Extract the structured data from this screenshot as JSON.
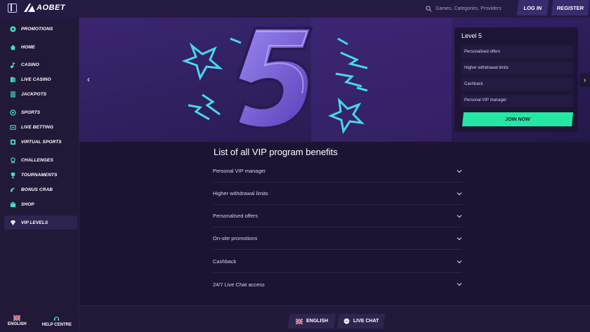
{
  "header": {
    "logo": "AOBET",
    "search_placeholder": "Games, Categories, Providers",
    "login_label": "LOG IN",
    "register_label": "REGISTER"
  },
  "sidebar": {
    "items": [
      {
        "label": "PROMOTIONS",
        "icon": "promotions-icon"
      },
      {
        "label": "HOME",
        "icon": "home-icon"
      },
      {
        "label": "CASINO",
        "icon": "casino-icon"
      },
      {
        "label": "LIVE CASINO",
        "icon": "live-casino-icon"
      },
      {
        "label": "JACKPOTS",
        "icon": "jackpots-icon"
      },
      {
        "label": "SPORTS",
        "icon": "sports-icon"
      },
      {
        "label": "LIVE BETTING",
        "icon": "live-betting-icon"
      },
      {
        "label": "VIRTUAL SPORTS",
        "icon": "virtual-sports-icon"
      },
      {
        "label": "CHALLENGES",
        "icon": "challenges-icon"
      },
      {
        "label": "TOURNAMENTS",
        "icon": "tournaments-icon"
      },
      {
        "label": "BONUS CRAB",
        "icon": "bonus-crab-icon"
      },
      {
        "label": "SHOP",
        "icon": "shop-icon"
      },
      {
        "label": "VIP LEVELS",
        "icon": "vip-levels-icon"
      }
    ],
    "active": "VIP LEVELS",
    "language_label": "ENGLISH",
    "help_label": "HELP CENTRE"
  },
  "level_card": {
    "title": "Level 5",
    "benefits": [
      "Personalised offers",
      "Higher withdrawal limits",
      "Cashback",
      "Personal VIP manager"
    ],
    "join_label": "JOIN NOW"
  },
  "main": {
    "title": "List of all VIP program benefits",
    "benefits": [
      "Personal VIP manager",
      "Higher withdrawal limits",
      "Personalised offers",
      "On-site promotions",
      "Cashback",
      "24/7 Live Chat access"
    ]
  },
  "footer": {
    "language_label": "ENGLISH",
    "chat_label": "LIVE CHAT"
  },
  "colors": {
    "background": "#1c1433",
    "accent": "#22e8a4",
    "hero": "#2b1d52",
    "button": "#3a2a6e"
  }
}
